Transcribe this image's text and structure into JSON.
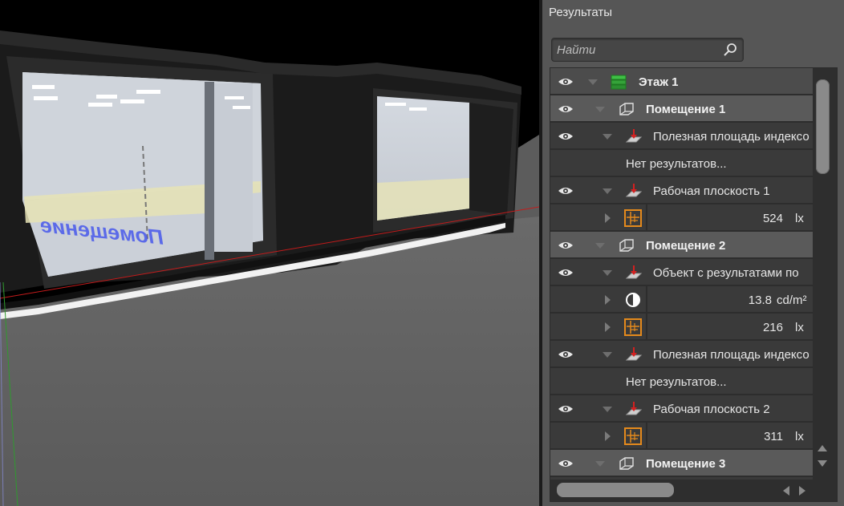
{
  "panel": {
    "title": "Результаты",
    "search_placeholder": "Найти"
  },
  "icons": {
    "eye": "eye-icon",
    "floor": "floor-icon",
    "room": "room-icon",
    "calc_surface": "calculation-surface-icon",
    "grid": "grid-result-icon",
    "luminance": "luminance-icon",
    "search": "search-icon"
  },
  "colors": {
    "accent_orange": "#e58a1c",
    "floor_green": "#35a33a",
    "arrow_red": "#d42020",
    "panel_bg": "#565656",
    "tree_bg": "#3a3a3a",
    "group_bg": "#5a5a5a"
  },
  "tree": {
    "floor1": "Этаж 1",
    "room1": "Помещение 1",
    "room1_useful_area": "Полезная площадь индексо",
    "room1_no_results": "Нет результатов...",
    "room1_work_plane": "Рабочая плоскость 1",
    "room1_work_plane_value": "524",
    "room1_work_plane_unit": "lx",
    "room2": "Помещение 2",
    "room2_object": "Объект с результатами по",
    "room2_object_luminance_value": "13.8",
    "room2_object_luminance_unit": "cd/m²",
    "room2_object_illuminance_value": "216",
    "room2_object_illuminance_unit": "lx",
    "room2_useful_area": "Полезная площадь индексо",
    "room2_no_results": "Нет результатов...",
    "room2_work_plane": "Рабочая плоскость 2",
    "room2_work_plane_value": "311",
    "room2_work_plane_unit": "lx",
    "room3": "Помещение 3"
  },
  "viewport": {
    "floor_text": "Помещение"
  }
}
